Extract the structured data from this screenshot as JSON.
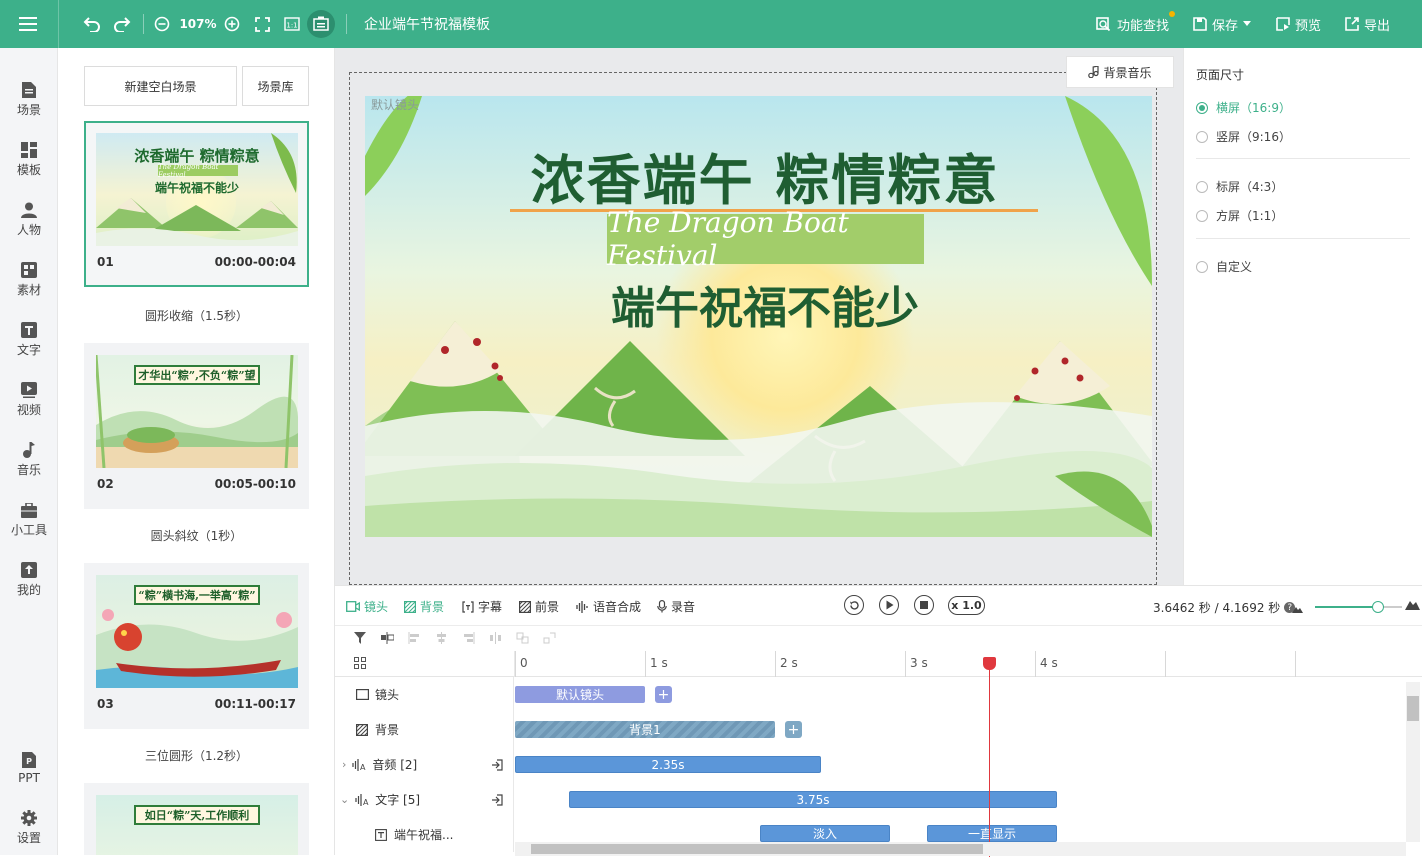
{
  "topbar": {
    "zoom": "107%",
    "doc_title": "企业端午节祝福模板",
    "feature_search": "功能查找",
    "save": "保存",
    "preview": "预览",
    "export": "导出",
    "bg_color": "#3db08a"
  },
  "nav": {
    "items": [
      {
        "label": "场景",
        "icon": "scene-icon"
      },
      {
        "label": "模板",
        "icon": "template-icon"
      },
      {
        "label": "人物",
        "icon": "person-icon"
      },
      {
        "label": "素材",
        "icon": "material-icon"
      },
      {
        "label": "文字",
        "icon": "text-icon"
      },
      {
        "label": "视频",
        "icon": "video-icon"
      },
      {
        "label": "音乐",
        "icon": "music-icon"
      },
      {
        "label": "小工具",
        "icon": "toolbox-icon"
      },
      {
        "label": "我的",
        "icon": "upload-icon"
      }
    ],
    "ppt": "PPT",
    "settings": "设置"
  },
  "scenes": {
    "new_blank": "新建空白场景",
    "library": "场景库",
    "list": [
      {
        "num": "01",
        "time": "00:00-00:04",
        "transition": "圆形收缩（1.5秒）",
        "caption": "浓香端午 粽情粽意",
        "subcaption": "端午祝福不能少",
        "script_text": "The Dragon Boat Festival"
      },
      {
        "num": "02",
        "time": "00:05-00:10",
        "transition": "圆头斜纹（1秒）",
        "caption": "才华出“粽”,不负“粽”望"
      },
      {
        "num": "03",
        "time": "00:11-00:17",
        "transition": "三位圆形（1.2秒）",
        "caption": "“粽”横书海,一举高“粽”"
      },
      {
        "caption": "如日“粽”天,工作顺利"
      }
    ]
  },
  "canvas": {
    "bg_music": "背景音乐",
    "lens_label": "默认镜头",
    "title": "浓香端午 粽情粽意",
    "script": "The Dragon Boat Festival",
    "subtitle": "端午祝福不能少"
  },
  "page_size": {
    "heading": "页面尺寸",
    "options": [
      {
        "label": "横屏（16:9）",
        "selected": true
      },
      {
        "label": "竖屏（9:16）",
        "selected": false
      },
      {
        "label": "标屏（4:3）",
        "selected": false
      },
      {
        "label": "方屏（1:1）",
        "selected": false
      },
      {
        "label": "自定义",
        "selected": false
      }
    ]
  },
  "timeline": {
    "tabs": [
      "镜头",
      "背景",
      "字幕",
      "前景",
      "语音合成",
      "录音"
    ],
    "speed": "x 1.0",
    "time_readout": "3.6462 秒 / 4.1692 秒",
    "zoom_level": 0.72,
    "ticks": [
      "0",
      "1 s",
      "2 s",
      "3 s",
      "4 s"
    ],
    "playhead_seconds": 3.6462,
    "tracks": [
      {
        "label": "镜头",
        "clip": "默认镜头"
      },
      {
        "label": "背景",
        "clip": "背景1"
      },
      {
        "label": "音频 [2]",
        "clip": "2.35s"
      },
      {
        "label": "文字 [5]",
        "clip": "3.75s"
      },
      {
        "label": "端午祝福...",
        "clips": [
          "淡入",
          "一直显示"
        ]
      }
    ]
  }
}
